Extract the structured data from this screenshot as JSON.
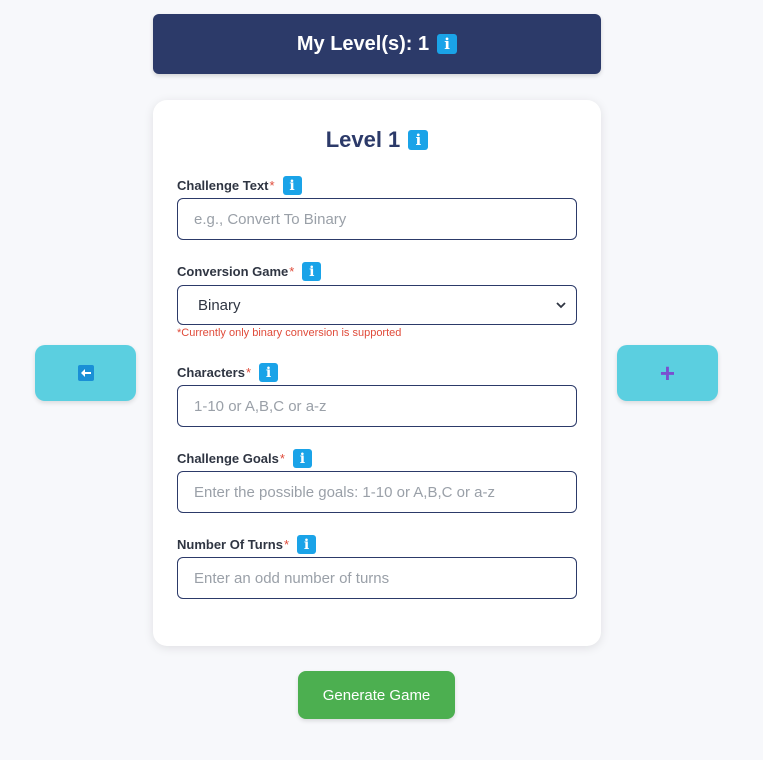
{
  "header": {
    "title": "My Level(s): 1",
    "info_glyph": "i"
  },
  "card": {
    "title": "Level 1",
    "info_glyph": "i",
    "fields": {
      "challenge_text": {
        "label": "Challenge Text",
        "required_mark": "*",
        "placeholder": "e.g., Convert To Binary",
        "value": ""
      },
      "conversion_game": {
        "label": "Conversion Game",
        "required_mark": "*",
        "selected": "Binary",
        "hint": "*Currently only binary conversion is supported"
      },
      "characters": {
        "label": "Characters",
        "required_mark": "*",
        "placeholder": "1-10 or A,B,C or a-z",
        "value": ""
      },
      "challenge_goals": {
        "label": "Challenge Goals",
        "required_mark": "*",
        "placeholder": "Enter the possible goals: 1-10 or A,B,C or a-z",
        "value": ""
      },
      "number_of_turns": {
        "label": "Number Of Turns",
        "required_mark": "*",
        "placeholder": "Enter an odd number of turns",
        "value": ""
      }
    }
  },
  "nav": {
    "back_icon": "arrow-left-icon",
    "add_icon": "plus-icon",
    "add_glyph": "+"
  },
  "actions": {
    "generate_label": "Generate Game"
  },
  "colors": {
    "header_bg": "#2c3a69",
    "info_blue": "#1aa3e8",
    "side_button": "#5bcfe0",
    "generate_green": "#4caf50",
    "required_red": "#e04b3a",
    "plus_purple": "#7a4fd0"
  }
}
